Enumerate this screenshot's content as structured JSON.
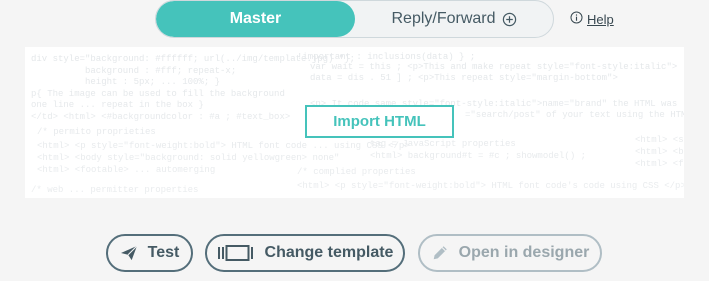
{
  "mode_toggle": {
    "master_label": "Master",
    "reply_label": "Reply/Forward"
  },
  "help": {
    "label": "Help"
  },
  "editor": {
    "import_label": "Import HTML"
  },
  "actions": {
    "test_label": "Test",
    "change_template_label": "Change template",
    "open_designer_label": "Open in designer"
  },
  "colors": {
    "accent": "#45c3bb",
    "text": "#455a64",
    "disabled": "#b0bec5"
  },
  "icons": {
    "reply_add": "plus-circle-icon",
    "help": "info-icon",
    "test": "paper-plane-icon",
    "template": "template-icon",
    "designer": "pencil-icon"
  }
}
